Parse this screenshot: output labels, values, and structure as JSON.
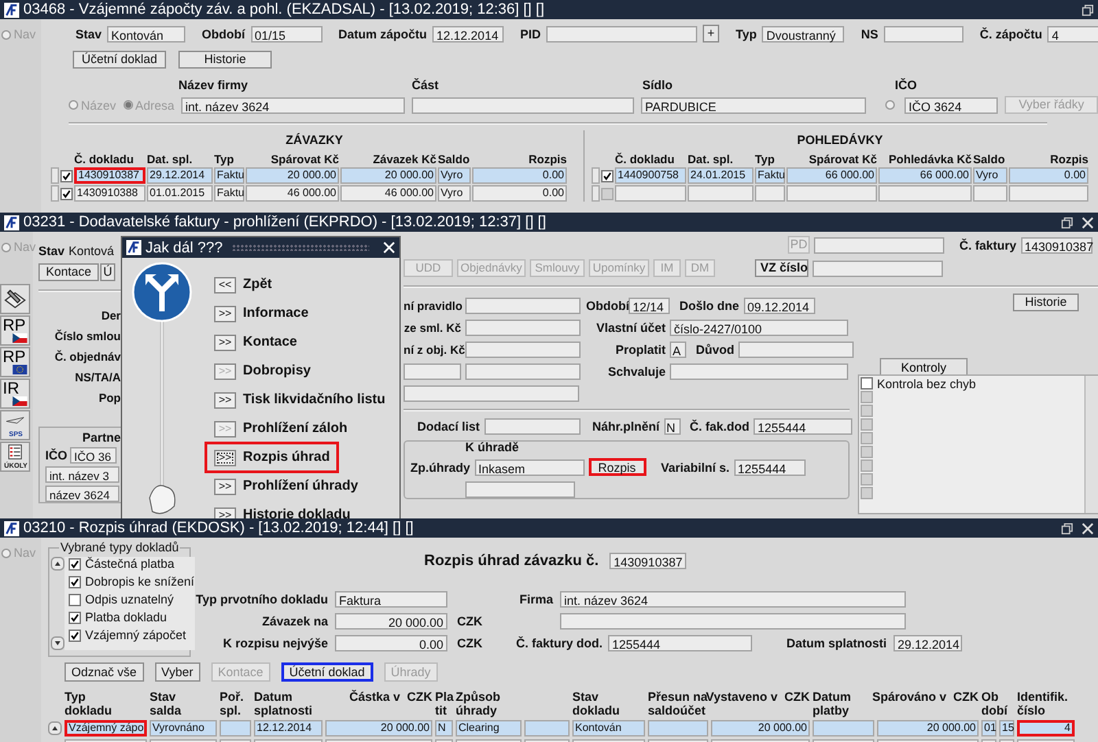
{
  "top_window": {
    "title": "03468 - Vzájemné zápočty záv. a pohl. (EKZADSAL) - [13.02.2019; 12:36] [] []",
    "nav": "Nav",
    "nav_selected": false,
    "header_fields": [
      {
        "label": "Stav",
        "value": "Kontován"
      },
      {
        "label": "Období",
        "value": "01/15"
      },
      {
        "label": "Datum zápočtu",
        "value": "12.12.2014"
      },
      {
        "label": "PID",
        "lookup_button": "+"
      },
      {
        "label": "Typ",
        "value": "Dvoustranný"
      },
      {
        "label": "NS"
      },
      {
        "label": "Č. zápočtu",
        "value": "4"
      }
    ],
    "buttons": [
      "Účetní doklad",
      "Historie"
    ],
    "firm": {
      "radios": [
        {
          "label": "Název",
          "selected": false
        },
        {
          "label": "Adresa",
          "selected": true
        }
      ],
      "name_label": "Název firmy",
      "name": "int. název 3624",
      "part_label": "Část",
      "seat_label": "Sídlo",
      "seat": "PARDUBICE",
      "ico_label": "IČO",
      "ico_selected": false,
      "ico": "IČO 3624",
      "select_rows": "Vyber řádky"
    },
    "liabilities": {
      "title": "ZÁVAZKY",
      "columns": [
        "Č. dokladu",
        "Dat. spl.",
        "Typ",
        "Spárovat Kč",
        "Závazek Kč",
        "Saldo",
        "Rozpis"
      ],
      "rows": [
        {
          "checked": true,
          "selected": true,
          "cells": [
            {
              "text": "1430910387",
              "marked": true
            },
            {
              "text": "29.12.2014",
              "marked": false
            },
            {
              "text": "Faktu",
              "marked": false
            },
            {
              "text": "20 000.00",
              "marked": false
            },
            {
              "text": "20 000.00",
              "marked": false
            },
            {
              "text": "Vyro",
              "marked": false
            },
            {
              "text": "0.00",
              "marked": false
            }
          ]
        },
        {
          "checked": true,
          "selected": false,
          "cells": [
            {
              "text": "1430910388",
              "marked": false
            },
            {
              "text": "01.01.2015",
              "marked": false
            },
            {
              "text": "Faktu",
              "marked": false
            },
            {
              "text": "46 000.00",
              "marked": false
            },
            {
              "text": "46 000.00",
              "marked": false
            },
            {
              "text": "Vyro",
              "marked": false
            },
            {
              "text": "0.00",
              "marked": false
            }
          ]
        }
      ]
    },
    "receivables": {
      "title": "POHLEDÁVKY",
      "columns": [
        "Č. dokladu",
        "Dat. spl.",
        "Typ",
        "Spárovat Kč",
        "Pohledávka Kč",
        "Saldo",
        "Rozpis"
      ],
      "rows": [
        {
          "checked": true,
          "selected": true,
          "cells": [
            {
              "text": "1440900758",
              "marked": false
            },
            {
              "text": "24.01.2015",
              "marked": false
            },
            {
              "text": "Faktu",
              "marked": false
            },
            {
              "text": "66 000.00",
              "marked": false
            },
            {
              "text": "66 000.00",
              "marked": false
            },
            {
              "text": "Vyro",
              "marked": false
            },
            {
              "text": "0.00",
              "marked": false
            }
          ]
        },
        {
          "checked": false,
          "selected": false,
          "cells": [
            {
              "marked": false
            },
            {
              "marked": false
            },
            {
              "marked": false
            },
            {
              "marked": false
            },
            {
              "marked": false
            },
            {
              "marked": false
            },
            {
              "marked": false
            }
          ]
        }
      ]
    }
  },
  "middle_window": {
    "title": "03231 - Dodavatelské faktury - prohlížení (EKPRDO) - [13.02.2019; 12:37] [] []",
    "nav": "Nav",
    "nav_selected": false,
    "tools": [
      {
        "kind": "pen"
      },
      {
        "kind": "cz",
        "label": "RP"
      },
      {
        "kind": "eu",
        "label": "RP"
      },
      {
        "kind": "cz",
        "label": "IR"
      },
      {
        "kind": "plane",
        "label": "SPS"
      },
      {
        "kind": "tasks",
        "label": "ÚKOLY"
      }
    ],
    "stav": {
      "label": "Stav",
      "value": "Kontová"
    },
    "left_buttons": [
      "Kontace",
      "Ú"
    ],
    "left_labels": [
      "Der",
      "Číslo smlou",
      "Č. objednáv",
      "NS/TA/A",
      "Pop"
    ],
    "partner": {
      "title": "Partne",
      "ico_label": "IČO",
      "fields": [
        "IČO 36",
        "int. název 3",
        "název 3624"
      ]
    },
    "pd_button": {
      "label": "PD",
      "disabled": true
    },
    "invoice": {
      "label": "Č. faktury",
      "value": "1430910387"
    },
    "toolbar": [
      {
        "label": "UDD",
        "disabled": true
      },
      {
        "label": "Objednávky",
        "disabled": true
      },
      {
        "label": "Smlouvy",
        "disabled": true
      },
      {
        "label": "Upomínky",
        "disabled": true
      },
      {
        "label": "IM",
        "disabled": true
      },
      {
        "label": "DM",
        "disabled": true
      }
    ],
    "vz_button": "VZ číslo",
    "cut_labels": [
      "ní pravidlo",
      "ze sml. Kč",
      "ní z obj. Kč"
    ],
    "period": {
      "label": "Období",
      "value": "12/14"
    },
    "received": {
      "label": "Došlo dne",
      "value": "09.12.2014"
    },
    "account": {
      "label": "Vlastní účet",
      "value": "číslo-2427/0100"
    },
    "pay": {
      "label": "Proplatit",
      "value": "A"
    },
    "reason": {
      "label": "Důvod"
    },
    "approver": {
      "label": "Schvaluje"
    },
    "history": "Historie",
    "checks": {
      "tab": "Kontroly",
      "items": [
        {
          "label": "Kontrola bez chyb",
          "checked": false
        },
        {
          "checked": false
        },
        {
          "checked": false
        },
        {
          "checked": false
        },
        {
          "checked": false
        },
        {
          "checked": false
        },
        {
          "checked": false
        },
        {
          "checked": false
        },
        {
          "checked": false
        }
      ]
    },
    "delivery": {
      "label": "Dodací list"
    },
    "substitute": {
      "label": "Náhr.plnění",
      "value": "N"
    },
    "supplier_invoice": {
      "label": "Č. fak.dod",
      "value": "1255444"
    },
    "payment": {
      "title": "K úhradě",
      "method_label": "Zp.úhrady",
      "method": "Inkasem",
      "button": {
        "label": "Rozpis",
        "marked": true
      },
      "vs_label": "Variabilní s.",
      "vs": "1255444"
    }
  },
  "dialog": {
    "title": "Jak dál ???",
    "items": [
      {
        "arrow": "<<",
        "label": "Zpět",
        "disabled": false,
        "marked": false
      },
      {
        "arrow": ">>",
        "label": "Informace",
        "disabled": false,
        "marked": false
      },
      {
        "arrow": ">>",
        "label": "Kontace",
        "disabled": false,
        "marked": false
      },
      {
        "arrow": ">>",
        "label": "Dobropisy",
        "disabled": true,
        "marked": false
      },
      {
        "arrow": ">>",
        "label": "Tisk likvidačního listu",
        "disabled": false,
        "marked": false
      },
      {
        "arrow": ">>",
        "label": "Prohlížení záloh",
        "disabled": true,
        "marked": false
      },
      {
        "arrow": ">>",
        "label": "Rozpis úhrad",
        "disabled": false,
        "marked": true
      },
      {
        "arrow": ">>",
        "label": "Prohlížení úhrady",
        "disabled": false,
        "marked": false
      },
      {
        "arrow": ">>",
        "label": "Historie dokladu",
        "disabled": false,
        "marked": false
      }
    ]
  },
  "bottom_window": {
    "title": "03210 - Rozpis úhrad (EKDOSK) - [13.02.2019; 12:44] [] []",
    "nav": "Nav",
    "nav_selected": false,
    "doc_types": {
      "title": "Vybrané typy dokladů",
      "items": [
        {
          "label": "Částečná platba",
          "checked": true
        },
        {
          "label": "Dobropis ke snížení",
          "checked": true
        },
        {
          "label": "Odpis uznatelný",
          "checked": false
        },
        {
          "label": "Platba dokladu",
          "checked": true
        },
        {
          "label": "Vzájemný zápočet",
          "checked": true
        }
      ]
    },
    "heading": "Rozpis úhrad závazku č.",
    "liability_no": "1430910387",
    "form": {
      "doc_type_label": "Typ prvotního dokladu",
      "doc_type": "Faktura",
      "amount_label": "Závazek na",
      "amount": "20 000.00",
      "amount_currency": "CZK",
      "max_label": "K rozpisu nejvýše",
      "max": "0.00",
      "max_currency": "CZK",
      "firm_label": "Firma",
      "firm": "int. název 3624",
      "supplier_invoice_label": "Č. faktury dod.",
      "supplier_invoice": "1255444",
      "due_label": "Datum splatnosti",
      "due": "29.12.2014"
    },
    "buttons": [
      {
        "label": "Odznač vše",
        "disabled": false,
        "marked": false
      },
      {
        "label": "Vyber",
        "disabled": false,
        "marked": false
      },
      {
        "label": "Kontace",
        "disabled": true,
        "marked": false
      },
      {
        "label": "Účetní doklad",
        "disabled": false,
        "marked": true
      },
      {
        "label": "Úhrady",
        "disabled": true,
        "marked": false
      }
    ],
    "table": {
      "columns": [
        {
          "label": "Typ\ndokladu"
        },
        {
          "label": "Stav\nsalda"
        },
        {
          "label": "Poř.\nspl."
        },
        {
          "label": "Datum\nsplatnosti"
        },
        {
          "label": "Částka v  CZK"
        },
        {
          "label": "Pla\ntit"
        },
        {
          "label": "Způsob\núhrady"
        },
        {},
        {
          "label": "Stav\ndokladu"
        },
        {
          "label": "Přesun na\nsaldoúčet"
        },
        {
          "label": "Vystaveno v  CZK"
        },
        {
          "label": "Datum\nplatby"
        },
        {
          "label": "Spárováno v  CZK"
        },
        {
          "label": "Ob\ndobí"
        },
        {},
        {
          "label": "Identifik.\nčíslo"
        }
      ],
      "rows": [
        {
          "selected": true,
          "cells": [
            {
              "text": "Vzájemný zápo",
              "marked": true
            },
            {
              "text": "Vyrovnáno",
              "marked": false
            },
            {
              "marked": false
            },
            {
              "text": "12.12.2014",
              "marked": false
            },
            {
              "text": "20 000.00",
              "marked": false
            },
            {
              "text": "N",
              "marked": false
            },
            {
              "text": "Clearing",
              "marked": false
            },
            {
              "marked": false
            },
            {
              "text": "Kontován",
              "marked": false
            },
            {
              "marked": false
            },
            {
              "text": "20 000.00",
              "marked": false
            },
            {
              "marked": false
            },
            {
              "text": "20 000.00",
              "marked": false
            },
            {
              "text": "01",
              "marked": false
            },
            {
              "text": "15",
              "marked": false
            },
            {
              "text": "4",
              "marked": true
            }
          ]
        },
        {
          "selected": false,
          "cells": [
            {
              "marked": false
            },
            {
              "marked": false
            },
            {
              "marked": false
            },
            {
              "marked": false
            },
            {
              "marked": false
            },
            {
              "marked": false
            },
            {
              "marked": false
            },
            {
              "marked": false
            },
            {
              "marked": false
            },
            {
              "marked": false
            },
            {
              "marked": false
            },
            {
              "marked": false
            },
            {
              "marked": false
            },
            {
              "marked": false
            },
            {
              "marked": false
            },
            {
              "marked": false
            }
          ]
        }
      ]
    }
  }
}
